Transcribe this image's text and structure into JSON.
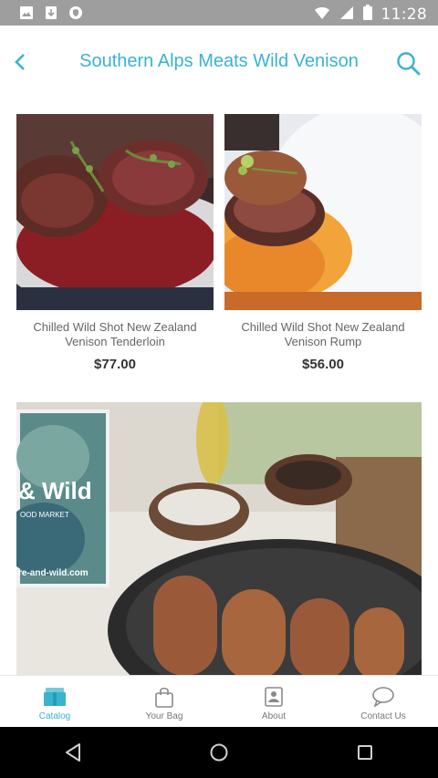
{
  "status_bar": {
    "time": "11:28",
    "icons": [
      "image-icon",
      "download-icon",
      "shield-icon",
      "wifi-icon",
      "signal-icon",
      "battery-icon"
    ]
  },
  "header": {
    "title": "Southern Alps Meats Wild Venison",
    "back_icon": "chevron-left-icon",
    "search_icon": "search-icon"
  },
  "products": [
    {
      "name": "Chilled Wild Shot New Zealand Venison Tenderloin",
      "price": "$77.00"
    },
    {
      "name": "Chilled Wild Shot New Zealand Venison Rump",
      "price": "$56.00"
    },
    {
      "name": "",
      "price": ""
    }
  ],
  "bottom_nav": {
    "tabs": [
      {
        "label": "Catalog",
        "icon": "catalog-icon",
        "active": true
      },
      {
        "label": "Your Bag",
        "icon": "bag-icon",
        "active": false
      },
      {
        "label": "About",
        "icon": "about-icon",
        "active": false
      },
      {
        "label": "Contact Us",
        "icon": "chat-icon",
        "active": false
      }
    ]
  },
  "colors": {
    "accent": "#39b3cf",
    "status_bar": "#9e9e9e",
    "nav_bar": "#000000",
    "text_secondary": "#666666",
    "price": "#333333"
  },
  "system_nav": [
    "back-icon",
    "home-icon",
    "recents-icon"
  ]
}
